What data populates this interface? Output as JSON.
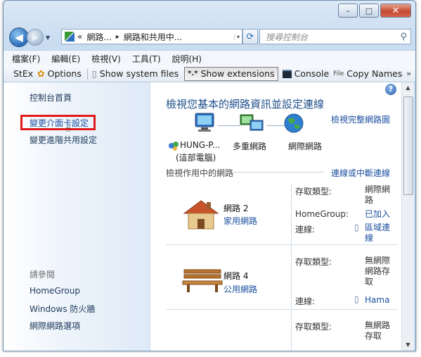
{
  "window": {
    "minimize": "–",
    "maximize": "□",
    "close": "✕"
  },
  "address": {
    "parts": [
      "«",
      "網路...",
      "▸",
      "網路和共用中..."
    ],
    "dropdown": "▾"
  },
  "search": {
    "placeholder": "搜尋控制台"
  },
  "menu": [
    "檔案(F)",
    "編輯(E)",
    "檢視(V)",
    "工具(T)",
    "說明(H)"
  ],
  "toolbar": {
    "stex": "StEx",
    "options": "Options",
    "show_system_files": "Show system files",
    "show_extensions": "Show extensions",
    "console": "Console",
    "copy_names": "Copy Names",
    "more": "»"
  },
  "sidebar": {
    "home": "控制台首頁",
    "change_adapter": "變更介面卡設定",
    "change_sharing": "變更進階共用設定",
    "see_also": "請參閱",
    "links": [
      "HomeGroup",
      "Windows 防火牆",
      "網際網路選項"
    ]
  },
  "main": {
    "title": "檢視您基本的網路資訊並設定連線",
    "view_full_map": "檢視完整網路圖",
    "map": {
      "computer": "HUNG-P...",
      "computer_sub": "(這部電腦)",
      "network": "多重網路",
      "internet": "網際網路"
    },
    "active_header": "檢視作用中的網路",
    "connect_disconnect": "連線或中斷連線",
    "networks": [
      {
        "name": "網路  2",
        "type": "家用網路",
        "access_label": "存取類型:",
        "access_value": "網際網路",
        "homegroup_label": "HomeGroup:",
        "homegroup_value": "已加入",
        "conn_label": "連線:",
        "conn_value": "區域連線"
      },
      {
        "name": "網路  4",
        "type": "公用網路",
        "access_label": "存取類型:",
        "access_value": "無網際網路存取",
        "conn_label": "連線:",
        "conn_value": "Hamac"
      },
      {
        "access_label": "存取類型:",
        "access_value": "無網路存取"
      }
    ]
  },
  "colors": {
    "highlight_box": "#e21a1a",
    "link": "#1d50a0",
    "title": "#1e4f8a"
  }
}
